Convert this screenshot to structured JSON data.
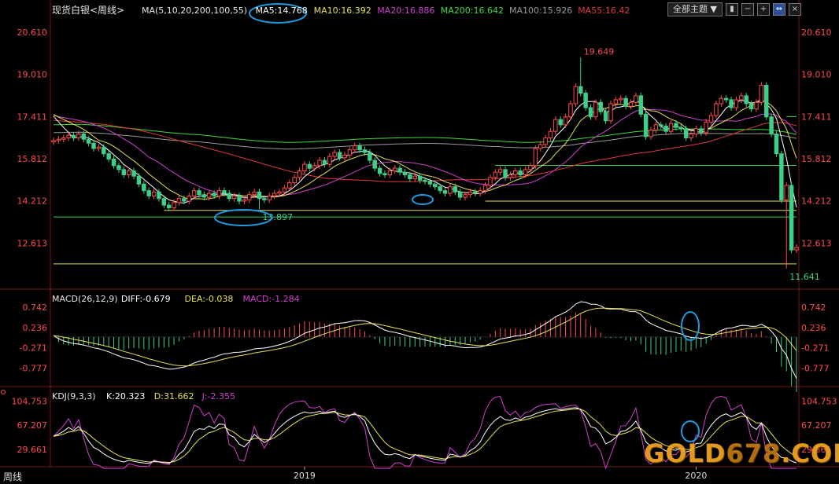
{
  "title": "现货白银<周线>",
  "corner_label": "周线",
  "toolbar": {
    "theme_select": "全部主题",
    "theme_caret": "▼",
    "icons": [
      "bar-chart",
      "zoom-out",
      "zoom-in",
      "move",
      "close"
    ]
  },
  "watermark": {
    "text_a": "GOLD",
    "text_b": "678",
    "text_c": ".COM"
  },
  "colors": {
    "up": "#ff4c4c",
    "down": "#3dcf8a",
    "ma5": "#ffffff",
    "ma10": "#e8e050",
    "ma20": "#d040d0",
    "ma200": "#40d840",
    "ma100": "#9a9a9a",
    "ma55": "#e03a3a"
  },
  "chart_data": [
    {
      "type": "candlestick",
      "panel": "price",
      "legend": {
        "ma_header": "MA(5,10,20,200,100,55)",
        "items": [
          {
            "label": "MA5:14.768",
            "color": "#ffffff"
          },
          {
            "label": "MA10:16.392",
            "color": "#e8e050"
          },
          {
            "label": "MA20:16.886",
            "color": "#d040d0"
          },
          {
            "label": "MA200:16.642",
            "color": "#40d840"
          },
          {
            "label": "MA100:15.926",
            "color": "#9a9a9a"
          },
          {
            "label": "MA55:16.42",
            "color": "#e03a3a"
          }
        ]
      },
      "y_ticks": [
        "20.610",
        "19.010",
        "17.411",
        "15.812",
        "14.212",
        "12.613"
      ],
      "y_tick_values": [
        20.61,
        19.01,
        17.411,
        15.812,
        14.212,
        12.613
      ],
      "ylim": [
        11.25,
        21.0
      ],
      "x_ticks": [
        "2019",
        "2020"
      ],
      "x_tick_index": [
        50,
        128
      ],
      "annotations": [
        {
          "text": "19.649",
          "value": 19.649,
          "index": 105
        },
        {
          "text": "13.897",
          "value": 13.897,
          "index": 41
        },
        {
          "text": "11.641",
          "value": 11.641,
          "index": 146
        }
      ],
      "hlines": [
        {
          "value": 17.411,
          "from": 146,
          "color": "#3dcf5a"
        },
        {
          "value": 15.56,
          "from": 88,
          "color": "#3dcf5a"
        },
        {
          "value": 14.2,
          "from": 86,
          "color": "#e8e050"
        },
        {
          "value": 13.6,
          "from": 0,
          "color": "#3dcf5a"
        },
        {
          "value": 13.85,
          "from": 22,
          "color": "#e8e050"
        },
        {
          "value": 11.82,
          "from": 0,
          "color": "#e8e050"
        }
      ],
      "close": [
        16.5,
        16.55,
        16.6,
        16.7,
        16.6,
        16.75,
        16.55,
        16.4,
        16.2,
        16.25,
        16.0,
        15.8,
        15.55,
        15.4,
        15.2,
        15.35,
        15.15,
        14.85,
        14.6,
        14.4,
        14.55,
        14.3,
        14.05,
        13.95,
        14.15,
        14.3,
        14.2,
        14.4,
        14.6,
        14.45,
        14.35,
        14.5,
        14.4,
        14.6,
        14.5,
        14.3,
        14.4,
        14.2,
        14.25,
        14.45,
        14.55,
        14.3,
        14.25,
        14.4,
        14.5,
        14.55,
        14.7,
        14.9,
        15.1,
        15.35,
        15.6,
        15.45,
        15.55,
        15.75,
        15.6,
        15.9,
        16.05,
        15.85,
        15.95,
        16.15,
        16.3,
        16.15,
        16.05,
        15.75,
        15.45,
        15.25,
        15.2,
        15.35,
        15.45,
        15.3,
        15.2,
        15.05,
        15.15,
        15.0,
        14.95,
        14.85,
        14.75,
        14.6,
        14.5,
        14.75,
        14.55,
        14.35,
        14.45,
        14.55,
        14.5,
        14.6,
        14.8,
        15.1,
        15.3,
        15.4,
        15.1,
        15.2,
        15.35,
        15.2,
        15.4,
        15.55,
        16.2,
        16.35,
        16.6,
        16.85,
        17.3,
        17.1,
        17.4,
        17.9,
        18.55,
        18.3,
        17.75,
        17.4,
        17.95,
        17.6,
        17.25,
        17.9,
        18.05,
        18.1,
        17.8,
        17.95,
        18.2,
        17.5,
        16.65,
        16.9,
        17.1,
        17.05,
        16.85,
        17.15,
        17.0,
        16.95,
        16.6,
        16.75,
        16.95,
        16.8,
        17.2,
        17.45,
        17.9,
        18.1,
        18.05,
        17.75,
        18.05,
        18.2,
        17.9,
        17.7,
        17.95,
        18.6,
        17.4,
        16.75,
        16.0,
        14.25,
        14.8,
        12.35,
        12.45
      ]
    },
    {
      "type": "line",
      "panel": "macd",
      "legend": {
        "header": "MACD(26,12,9)",
        "items": [
          {
            "label": "DIFF:-0.679",
            "color": "#ffffff"
          },
          {
            "label": "DEA:-0.038",
            "color": "#e8e050"
          },
          {
            "label": "MACD:-1.284",
            "color": "#d040d0"
          }
        ]
      },
      "y_ticks": [
        "0.742",
        "0.236",
        "-0.271",
        "-0.777"
      ],
      "y_tick_values": [
        0.742,
        0.236,
        -0.271,
        -0.777
      ],
      "ylim": [
        -1.2,
        1.0
      ]
    },
    {
      "type": "line",
      "panel": "kdj",
      "legend": {
        "header": "KDJ(9,3,3)",
        "items": [
          {
            "label": "K:20.323",
            "color": "#ffffff"
          },
          {
            "label": "D:31.662",
            "color": "#e8e050"
          },
          {
            "label": "J:-2.355",
            "color": "#d040d0"
          }
        ]
      },
      "y_ticks": [
        "104.753",
        "67.207",
        "29.661"
      ],
      "y_tick_values": [
        104.753,
        67.207,
        29.661
      ],
      "ylim": [
        5,
        115
      ]
    }
  ]
}
